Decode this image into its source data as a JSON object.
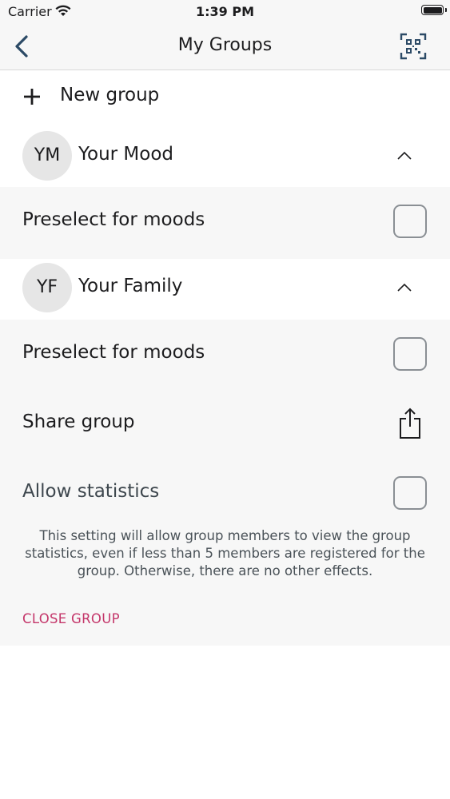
{
  "status_bar": {
    "carrier": "Carrier",
    "time": "1:39 PM"
  },
  "nav": {
    "title": "My Groups",
    "back_icon": "chevron-left-icon",
    "qr_icon": "qr-code-scanner-icon"
  },
  "new_group": {
    "label": "New group",
    "icon": "plus-icon"
  },
  "groups": [
    {
      "initials": "YM",
      "name": "Your Mood",
      "preselect_label": "Preselect for moods"
    },
    {
      "initials": "YF",
      "name": "Your Family",
      "preselect_label": "Preselect for moods",
      "share_label": "Share group",
      "share_icon": "share-icon",
      "statistics_label": "Allow statistics",
      "statistics_info": "This setting will allow group members to view the group statistics, even if less than 5 members are registered for the group. Otherwise, there are no other effects.",
      "close_label": "CLOSE GROUP"
    }
  ],
  "colors": {
    "accent_close": "#c4366a",
    "section_bg": "#f7f7f7",
    "avatar_bg": "#e6e6e6"
  }
}
